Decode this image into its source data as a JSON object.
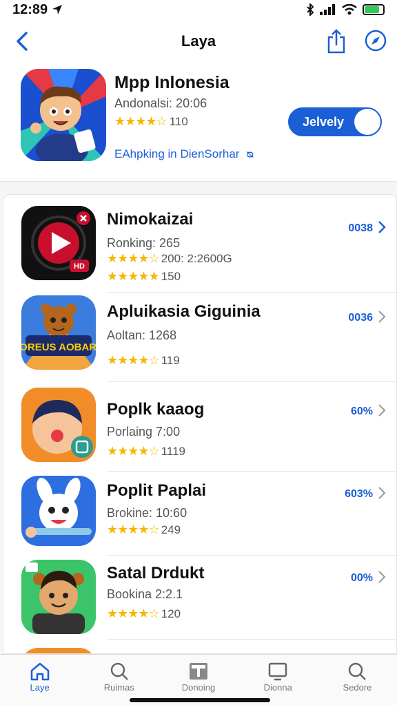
{
  "status": {
    "time": "12:89"
  },
  "nav": {
    "title": "Laya"
  },
  "featured": {
    "title": "Mpp Inlonesia",
    "subtitle": "Andonalsi: 20:06",
    "stars": "★★★★☆",
    "rating_count": "110",
    "link": "EAhpking in DienSorhar",
    "link_icon": "ᴓ",
    "button_label": "Jelvely"
  },
  "apps": [
    {
      "name": "Nimokaizai",
      "sub": "Ronking: 265",
      "extra_stars": "★★★★☆",
      "extra": "200: 2:2600G",
      "stars": "★★★★★",
      "rating": "150",
      "pct": "0038"
    },
    {
      "name": "Apluikasia Giguinia",
      "sub": "Aoltan: 1268",
      "stars": "★★★★☆",
      "rating": "119",
      "pct": "0036"
    },
    {
      "name": "Poplk kaaog",
      "sub": "Porlaing 7:00",
      "stars": "★★★★☆",
      "rating": "1119",
      "pct": "60%"
    },
    {
      "name": "Poplit Paplai",
      "sub": "Brokine: 10:60",
      "stars": "★★★★☆",
      "rating": "249",
      "pct": "603%"
    },
    {
      "name": "Satal Drdukt",
      "sub": "Bookina 2:2.1",
      "stars": "★★★★☆",
      "rating": "120",
      "pct": "00%"
    }
  ],
  "icon_texts": {
    "apps_1": "LOREUS AOBARA",
    "apps_0_badge": "HD"
  },
  "tabs": [
    {
      "label": "Laye",
      "icon": "home-icon"
    },
    {
      "label": "Ruimas",
      "icon": "search-icon"
    },
    {
      "label": "Donoing",
      "icon": "calendar-icon"
    },
    {
      "label": "Dionna",
      "icon": "monitor-icon"
    },
    {
      "label": "Sedore",
      "icon": "search-icon"
    }
  ],
  "colors": {
    "accent": "#1a5fd6",
    "star": "#f5b800"
  }
}
